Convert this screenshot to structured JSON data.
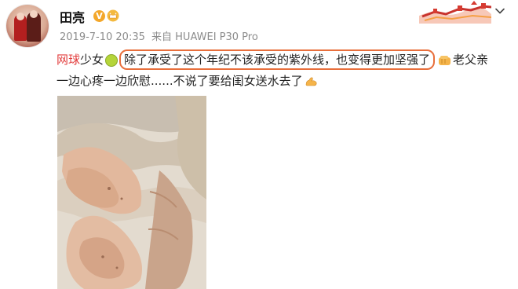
{
  "post": {
    "username": "田亮",
    "timestamp": "2019-7-10 20:35",
    "source": "来自 HUAWEI P30 Pro",
    "tag": "网球",
    "text_before_highlight": "少女",
    "highlighted_text": "除了承受了这个年纪不该承受的紫外线，也变得更加坚强了",
    "text_after_highlight": "老父亲",
    "line2_text": "一边心疼一边欣慰......不说了要给闺女送水去了",
    "verified_badge": "V"
  },
  "colors": {
    "highlight_border": "#e86f3c",
    "tag": "#e23c3c",
    "muted": "#8c8c8c"
  },
  "icons": {
    "avatar": "avatar-icon",
    "verified": "verified-badge-icon",
    "crown": "crown-icon",
    "banner": "great-wall-banner-icon",
    "chevron": "chevron-down-icon",
    "tennis_ball": "tennis-ball-icon",
    "fist": "fist-bump-icon",
    "muscle": "muscle-icon"
  }
}
